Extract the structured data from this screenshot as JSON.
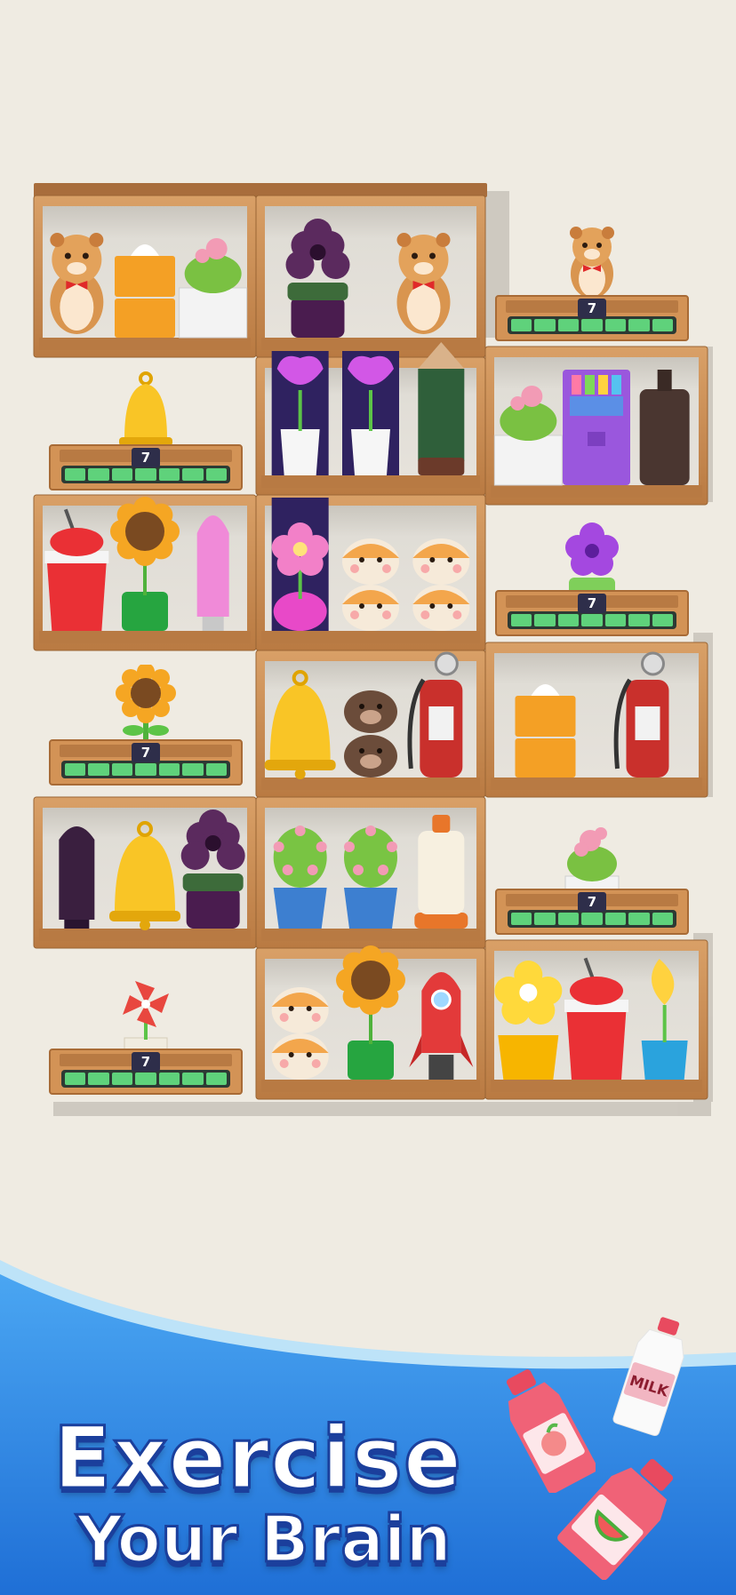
{
  "headline": {
    "line1": "Exercise",
    "line2": "Your Brain"
  },
  "trays": [
    {
      "count": "7",
      "toy": "hamster-toy"
    },
    {
      "count": "7",
      "toy": "bell-toy"
    },
    {
      "count": "7",
      "toy": "purple-flower-toy"
    },
    {
      "count": "7",
      "toy": "sunflower-toy"
    },
    {
      "count": "7",
      "toy": "cactus-toy"
    },
    {
      "count": "7",
      "toy": "pinwheel-toy"
    }
  ],
  "bottles": {
    "milk_label": "MILK"
  },
  "colors": {
    "background": "#efebe2",
    "wood": "#c98d52",
    "banner_blue": "#2f8ee8",
    "progress_green": "#5fd27b",
    "badge": "#2e2e4a"
  }
}
